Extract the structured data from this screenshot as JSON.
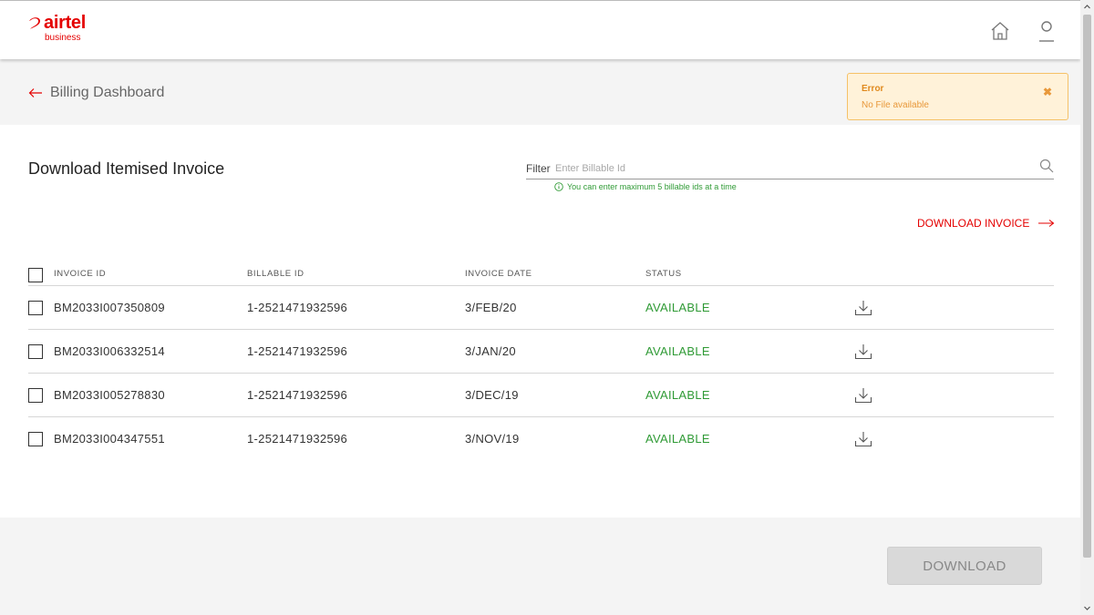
{
  "header": {
    "logo_main": "airtel",
    "logo_sub": "business",
    "icons": [
      "home-icon",
      "user-icon"
    ]
  },
  "subheader": {
    "back_label": "Billing Dashboard"
  },
  "toast": {
    "title": "Error",
    "message": "No File available",
    "close_glyph": "✖"
  },
  "main": {
    "title": "Download Itemised Invoice",
    "filter_label": "Filter",
    "filter_placeholder": "Enter Billable Id",
    "filter_value": "",
    "hint": "You can enter maximum 5 billable ids at a time",
    "download_invoice_label": "DOWNLOAD INVOICE"
  },
  "table": {
    "columns": [
      "INVOICE ID",
      "BILLABLE ID",
      "INVOICE DATE",
      "STATUS"
    ],
    "rows": [
      {
        "invoice_id": "BM2033I007350809",
        "billable_id": "1-2521471932596",
        "date": "3/FEB/20",
        "status": "AVAILABLE"
      },
      {
        "invoice_id": "BM2033I006332514",
        "billable_id": "1-2521471932596",
        "date": "3/JAN/20",
        "status": "AVAILABLE"
      },
      {
        "invoice_id": "BM2033I005278830",
        "billable_id": "1-2521471932596",
        "date": "3/DEC/19",
        "status": "AVAILABLE"
      },
      {
        "invoice_id": "BM2033I004347551",
        "billable_id": "1-2521471932596",
        "date": "3/NOV/19",
        "status": "AVAILABLE"
      }
    ]
  },
  "footer": {
    "download_label": "DOWNLOAD"
  },
  "colors": {
    "brand": "#e40000",
    "status_available": "#2f9a35",
    "error_bg": "#fff2d9",
    "error_border": "#f5c167",
    "error_text": "#e08a1e"
  }
}
